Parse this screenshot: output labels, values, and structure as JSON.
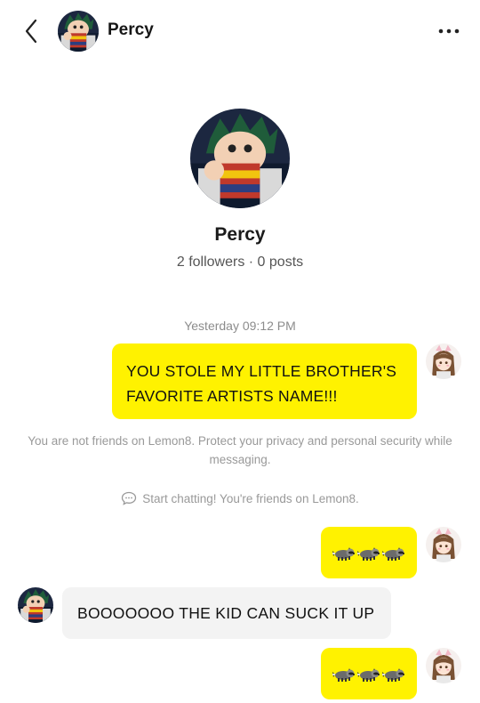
{
  "header": {
    "name": "Percy"
  },
  "profile": {
    "name": "Percy",
    "stats": "2 followers · 0 posts"
  },
  "conversation": {
    "timestamp": "Yesterday 09:12 PM",
    "messages": [
      {
        "side": "right",
        "text": "YOU STOLE MY LITTLE BROTHER'S FAVORITE ARTISTS NAME!!!"
      },
      {
        "side": "right",
        "emoji": [
          "raccoon",
          "raccoon",
          "raccoon"
        ]
      },
      {
        "side": "left",
        "text": "BOOOOOOO THE KID CAN SUCK IT UP"
      },
      {
        "side": "right",
        "emoji": [
          "raccoon",
          "raccoon",
          "raccoon"
        ]
      }
    ],
    "privacy_notice": "You are not friends on Lemon8. Protect your privacy and personal security while messaging.",
    "start_notice": "Start chatting! You're friends on Lemon8."
  },
  "colors": {
    "my_bubble": "#fff200",
    "their_bubble": "#f3f3f3",
    "muted_text": "#999999"
  }
}
